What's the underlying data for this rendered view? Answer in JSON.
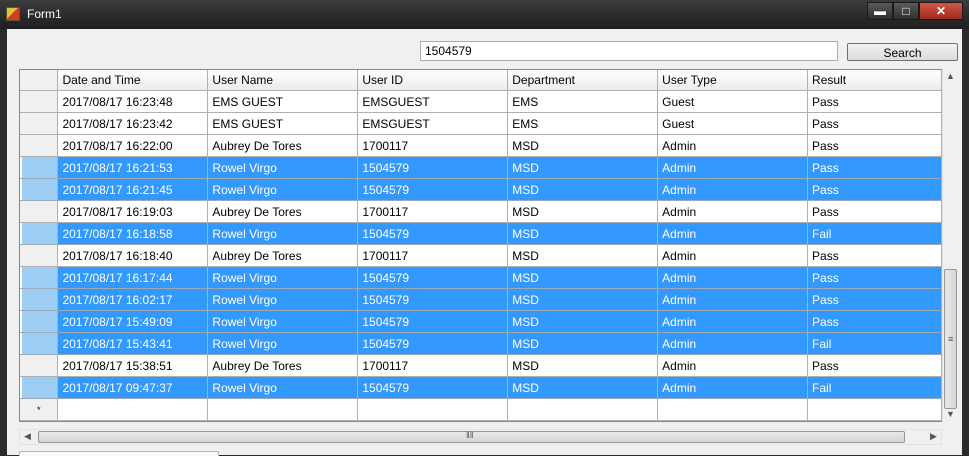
{
  "window": {
    "title": "Form1"
  },
  "search": {
    "value": "1504579",
    "button_label": "Search"
  },
  "grid": {
    "columns": [
      "Date and Time",
      "User Name",
      "User ID",
      "Department",
      "User Type",
      "Result"
    ],
    "rows": [
      {
        "selected": false,
        "cells": [
          "2017/08/17 16:23:48",
          "EMS GUEST",
          "EMSGUEST",
          "EMS",
          "Guest",
          "Pass"
        ]
      },
      {
        "selected": false,
        "cells": [
          "2017/08/17 16:23:42",
          "EMS GUEST",
          "EMSGUEST",
          "EMS",
          "Guest",
          "Pass"
        ]
      },
      {
        "selected": false,
        "cells": [
          "2017/08/17 16:22:00",
          "Aubrey De Tores",
          "1700117",
          "MSD",
          "Admin",
          "Pass"
        ]
      },
      {
        "selected": true,
        "cells": [
          "2017/08/17 16:21:53",
          "Rowel Virgo",
          "1504579",
          "MSD",
          "Admin",
          "Pass"
        ]
      },
      {
        "selected": true,
        "cells": [
          "2017/08/17 16:21:45",
          "Rowel Virgo",
          "1504579",
          "MSD",
          "Admin",
          "Pass"
        ]
      },
      {
        "selected": false,
        "cells": [
          "2017/08/17 16:19:03",
          "Aubrey De Tores",
          "1700117",
          "MSD",
          "Admin",
          "Pass"
        ]
      },
      {
        "selected": true,
        "cells": [
          "2017/08/17 16:18:58",
          "Rowel Virgo",
          "1504579",
          "MSD",
          "Admin",
          "Fail"
        ]
      },
      {
        "selected": false,
        "cells": [
          "2017/08/17 16:18:40",
          "Aubrey De Tores",
          "1700117",
          "MSD",
          "Admin",
          "Pass"
        ]
      },
      {
        "selected": true,
        "cells": [
          "2017/08/17 16:17:44",
          "Rowel Virgo",
          "1504579",
          "MSD",
          "Admin",
          "Pass"
        ]
      },
      {
        "selected": true,
        "cells": [
          "2017/08/17 16:02:17",
          "Rowel Virgo",
          "1504579",
          "MSD",
          "Admin",
          "Pass"
        ]
      },
      {
        "selected": true,
        "cells": [
          "2017/08/17 15:49:09",
          "Rowel Virgo",
          "1504579",
          "MSD",
          "Admin",
          "Pass"
        ]
      },
      {
        "selected": true,
        "cells": [
          "2017/08/17 15:43:41",
          "Rowel Virgo",
          "1504579",
          "MSD",
          "Admin",
          "Fail"
        ]
      },
      {
        "selected": false,
        "cells": [
          "2017/08/17 15:38:51",
          "Aubrey De Tores",
          "1700117",
          "MSD",
          "Admin",
          "Pass"
        ]
      },
      {
        "selected": true,
        "cells": [
          "2017/08/17 09:47:37",
          "Rowel Virgo",
          "1504579",
          "MSD",
          "Admin",
          "Fail"
        ]
      }
    ],
    "new_row_marker": "*"
  },
  "colors": {
    "selection": "#3399ff",
    "title_bar": "#2b2b2b",
    "close_button": "#c0392b"
  },
  "icons": {
    "app": "app-icon",
    "minimize": "minimize-icon",
    "maximize": "maximize-icon",
    "close": "close-icon",
    "scroll_up": "scroll-up-arrow-icon",
    "scroll_down": "scroll-down-arrow-icon",
    "scroll_left": "scroll-left-arrow-icon",
    "scroll_right": "scroll-right-arrow-icon"
  }
}
